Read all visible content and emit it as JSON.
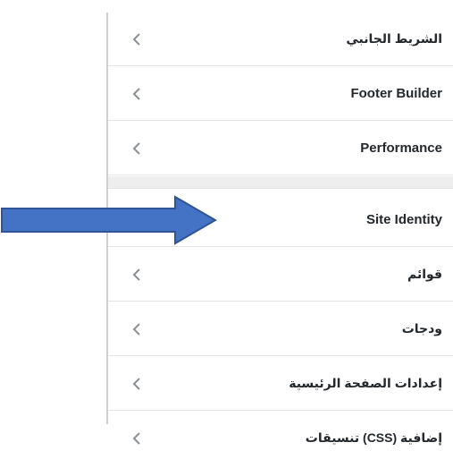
{
  "menu": {
    "items": [
      {
        "label": "الشريط الجانبي",
        "icon": "chevron-left-icon"
      },
      {
        "label": "Footer Builder",
        "icon": "chevron-left-icon"
      },
      {
        "label": "Performance",
        "icon": "chevron-left-icon"
      },
      {
        "label": "Site Identity",
        "icon": "arrow-right-icon"
      },
      {
        "label": "قوائم",
        "icon": "chevron-left-icon"
      },
      {
        "label": "ودجات",
        "icon": "chevron-left-icon"
      },
      {
        "label": "إعدادات الصفحة الرئيسية",
        "icon": "chevron-left-icon"
      },
      {
        "label": "تنسيقات (CSS) إضافية",
        "icon": "chevron-left-icon"
      }
    ]
  },
  "colors": {
    "arrow_fill": "#4472c4",
    "arrow_stroke": "#2f5597",
    "chevron": "#8a8f94",
    "label": "#23282d"
  }
}
